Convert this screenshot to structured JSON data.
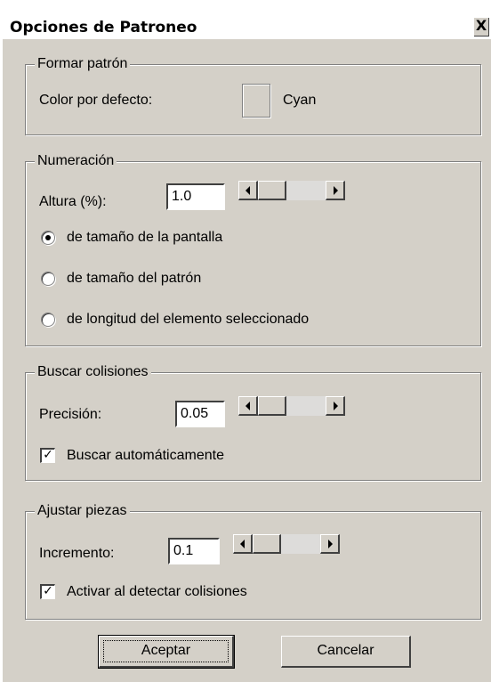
{
  "window": {
    "title": "Opciones de Patroneo",
    "close_glyph": "X"
  },
  "format_pattern": {
    "legend": "Formar patrón",
    "default_color_label": "Color por defecto:",
    "default_color_name": "Cyan"
  },
  "numbering": {
    "legend": "Numeración",
    "height_label": "Altura (%):",
    "height_value": "1.0",
    "options": [
      {
        "label": "de tamaño de la pantalla",
        "selected": true
      },
      {
        "label": "de tamaño del patrón",
        "selected": false
      },
      {
        "label": "de longitud del elemento seleccionado",
        "selected": false
      }
    ]
  },
  "collisions": {
    "legend": "Buscar colisiones",
    "precision_label": "Precisión:",
    "precision_value": "0.05",
    "auto_search_label": "Buscar automáticamente",
    "auto_search_checked": true
  },
  "adjust": {
    "legend": "Ajustar piezas",
    "increment_label": "Incremento:",
    "increment_value": "0.1",
    "activate_label": "Activar al detectar colisiones",
    "activate_checked": true
  },
  "buttons": {
    "ok": "Aceptar",
    "cancel": "Cancelar"
  },
  "icons": {
    "close": "close-icon",
    "scroll_left": "arrow-left-icon",
    "scroll_right": "arrow-right-icon",
    "checkmark": "checkmark-icon"
  },
  "colors": {
    "dialog_bg": "#d4d0c8",
    "titlebar_bg": "#ffffff",
    "swatch": "#d4d0c8"
  }
}
